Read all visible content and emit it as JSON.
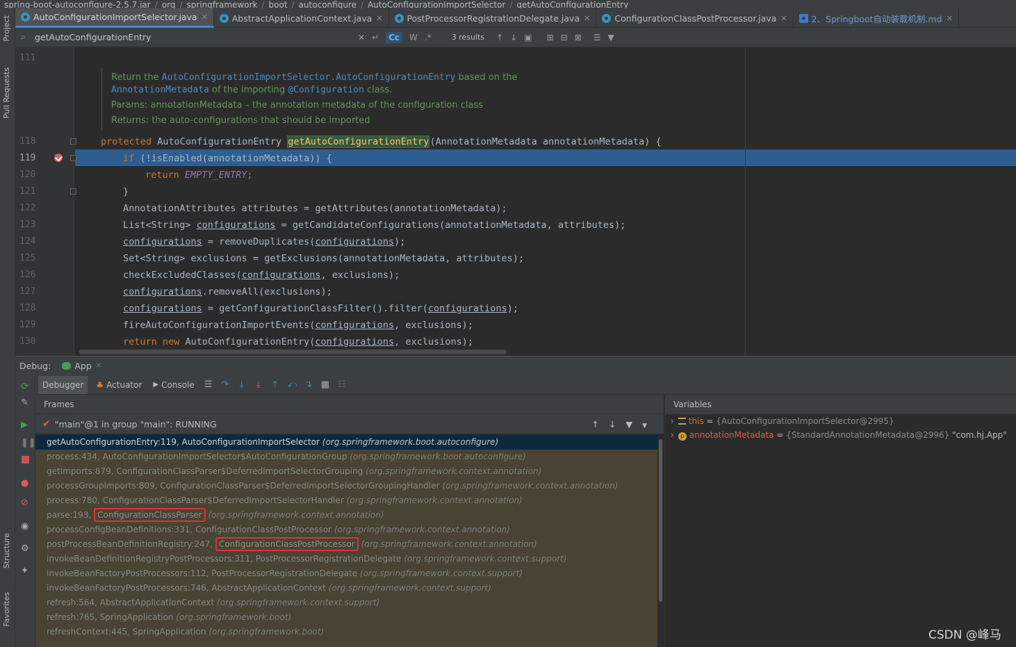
{
  "breadcrumb": [
    "spring-boot-autoconfigure-2.5.7.jar",
    "org",
    "springframework",
    "boot",
    "autoconfigure",
    "AutoConfigurationImportSelector",
    "getAutoConfigurationEntry"
  ],
  "left_strip": {
    "project": "Project",
    "pull_requests": "Pull Requests",
    "structure": "Structure",
    "favorites": "Favorites"
  },
  "tabs": [
    {
      "label": "AutoConfigurationImportSelector.java",
      "active": true
    },
    {
      "label": "AbstractApplicationContext.java",
      "active": false
    },
    {
      "label": "PostProcessorRegistrationDelegate.java",
      "active": false
    },
    {
      "label": "ConfigurationClassPostProcessor.java",
      "active": false
    },
    {
      "label": "2、Springboot自动装载机制.md",
      "active": false
    }
  ],
  "search": {
    "query": "getAutoConfigurationEntry",
    "results": "3 results",
    "case_label": "Cc",
    "word_label": "W",
    "regex_label": ".*"
  },
  "editor": {
    "line_111": "111",
    "doc": {
      "l1_a": "Return the ",
      "l1_b": "AutoConfigurationImportSelector.AutoConfigurationEntry",
      "l1_c": " based on the",
      "l2_a": "AnnotationMetadata",
      "l2_b": " of the importing ",
      "l2_c": "@Configuration",
      "l2_d": " class.",
      "l3": "Params:  annotationMetadata – the annotation metadata of the configuration class",
      "l4": "Returns: the auto-configurations that should be imported"
    },
    "lines": [
      "118",
      "119",
      "120",
      "121",
      "122",
      "123",
      "124",
      "125",
      "126",
      "127",
      "128",
      "129",
      "130"
    ],
    "code": {
      "c118_a": "protected",
      "c118_b": " AutoConfigurationEntry ",
      "c118_c": "getAutoConfigurationEntry",
      "c118_d": "(AnnotationMetadata annotationMetadata) {",
      "c119_a": "if",
      "c119_b": " (!isEnabled(annotationMetadata)) {",
      "c120_a": "return",
      "c120_b": "EMPTY_ENTRY",
      "c120_c": ";",
      "c121": "}",
      "c122": "AnnotationAttributes attributes = getAttributes(annotationMetadata);",
      "c123_a": "List<String> ",
      "c123_b": "configurations",
      "c123_c": " = getCandidateConfigurations(annotationMetadata, attributes);",
      "c124_a": "configurations",
      "c124_b": " = removeDuplicates(",
      "c124_c": "configurations",
      "c124_d": ");",
      "c125": "Set<String> exclusions = getExclusions(annotationMetadata, attributes);",
      "c126_a": "checkExcludedClasses(",
      "c126_b": "configurations",
      "c126_c": ", exclusions);",
      "c127_a": "configurations",
      "c127_b": ".removeAll(exclusions);",
      "c128_a": "configurations",
      "c128_b": " = getConfigurationClassFilter().filter(",
      "c128_c": "configurations",
      "c128_d": ");",
      "c129_a": "fireAutoConfigurationImportEvents(",
      "c129_b": "configurations",
      "c129_c": ", exclusions);",
      "c130_a": "return",
      "c130_b": "new",
      "c130_c": " AutoConfigurationEntry(",
      "c130_d": "configurations",
      "c130_e": ", exclusions);"
    }
  },
  "debug": {
    "label": "Debug:",
    "config": "App",
    "tabs": {
      "debugger": "Debugger",
      "actuator": "Actuator",
      "console": "Console"
    },
    "frames_header": "Frames",
    "variables_header": "Variables",
    "thread": "\"main\"@1 in group \"main\": RUNNING",
    "frames": [
      {
        "m": "getAutoConfigurationEntry:119, AutoConfigurationImportSelector",
        "p": "(org.springframework.boot.autoconfigure)"
      },
      {
        "m": "process:434, AutoConfigurationImportSelector$AutoConfigurationGroup",
        "p": "(org.springframework.boot.autoconfigure)"
      },
      {
        "m": "getImports:879, ConfigurationClassParser$DeferredImportSelectorGrouping",
        "p": "(org.springframework.context.annotation)"
      },
      {
        "m": "processGroupImports:809, ConfigurationClassParser$DeferredImportSelectorGroupingHandler",
        "p": "(org.springframework.context.annotation)"
      },
      {
        "m": "process:780, ConfigurationClassParser$DeferredImportSelectorHandler",
        "p": "(org.springframework.context.annotation)"
      },
      {
        "m1": "parse:193, ",
        "cls": "ConfigurationClassParser",
        "p": "(org.springframework.context.annotation)"
      },
      {
        "m": "processConfigBeanDefinitions:331, ConfigurationClassPostProcessor",
        "p": "(org.springframework.context.annotation)"
      },
      {
        "m1": "postProcessBeanDefinitionRegistry:247, ",
        "cls": "ConfigurationClassPostProcessor",
        "p": "(org.springframework.context.annotation)"
      },
      {
        "m": "invokeBeanDefinitionRegistryPostProcessors:311, PostProcessorRegistrationDelegate",
        "p": "(org.springframework.context.support)"
      },
      {
        "m": "invokeBeanFactoryPostProcessors:112, PostProcessorRegistrationDelegate",
        "p": "(org.springframework.context.support)"
      },
      {
        "m": "invokeBeanFactoryPostProcessors:746, AbstractApplicationContext",
        "p": "(org.springframework.context.support)"
      },
      {
        "m": "refresh:564, AbstractApplicationContext",
        "p": "(org.springframework.context.support)"
      },
      {
        "m": "refresh:765, SpringApplication",
        "p": "(org.springframework.boot)"
      },
      {
        "m": "refreshContext:445, SpringApplication",
        "p": "(org.springframework.boot)"
      }
    ],
    "variables": [
      {
        "name": "this",
        "eq": " = ",
        "value": "{AutoConfigurationImportSelector@2995}",
        "str": ""
      },
      {
        "name": "annotationMetadata",
        "eq": " = ",
        "value": "{StandardAnnotationMetadata@2996}",
        "str": " \"com.hj.App\""
      }
    ]
  },
  "watermark": "CSDN @峰马",
  "colors": {
    "accent": "#4a88c7",
    "current_line": "#2d5e8f",
    "highlight_box": "#e0313a",
    "frames_bg": "#484332"
  }
}
